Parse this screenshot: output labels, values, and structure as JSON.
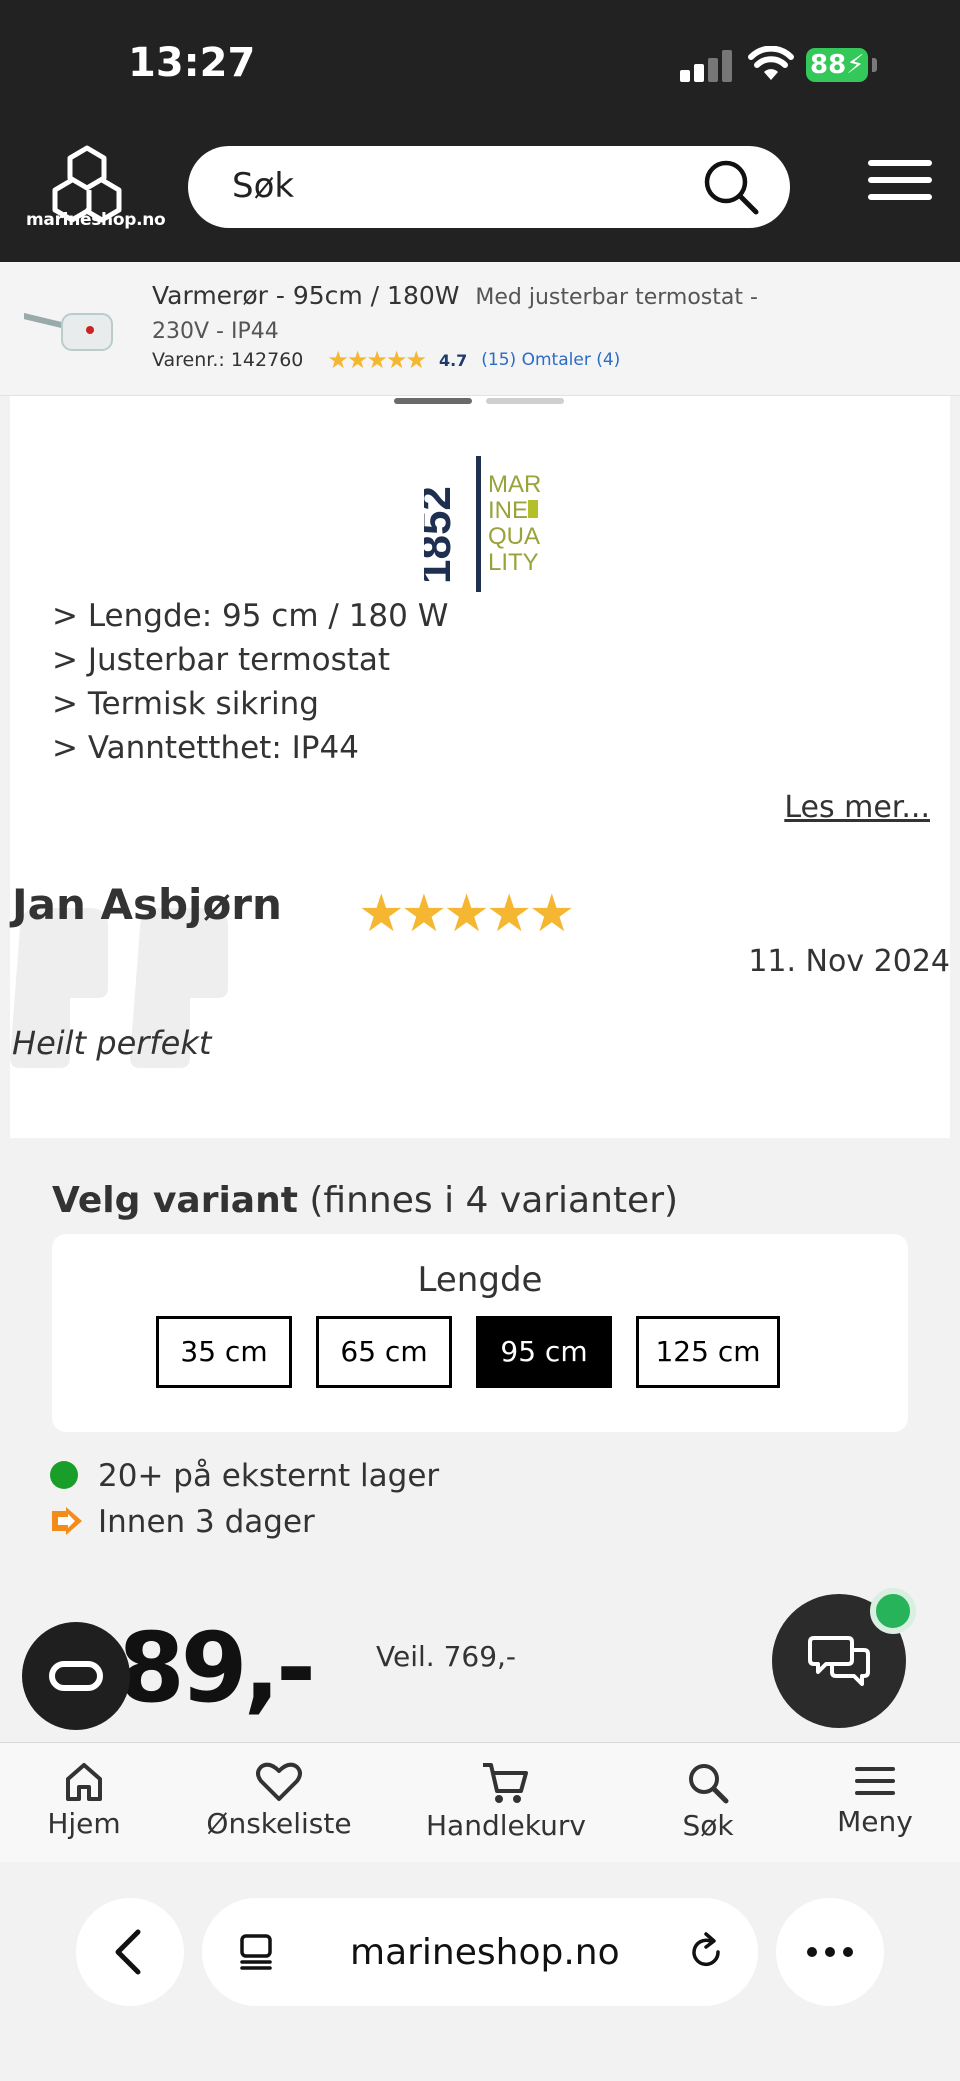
{
  "status_bar": {
    "time": "13:27",
    "battery": "88"
  },
  "header": {
    "logo_text": "marineshop.no",
    "search_placeholder": "Søk"
  },
  "product": {
    "title": "Varmerør - 95cm / 180W",
    "subtitle": "Med justerbar termostat - 230V - IP44",
    "sku": "Varenr.: 142760",
    "rating": "4.7",
    "rating_count": "(15)",
    "reviews_link": "Omtaler (4)"
  },
  "brand": {
    "year": "1852",
    "lines": [
      "MAR",
      "INE",
      "QUA",
      "LITY"
    ]
  },
  "features": [
    "> Lengde: 95 cm / 180 W",
    "> Justerbar termostat",
    "> Termisk sikring",
    "> Vanntetthet: IP44"
  ],
  "read_more": "Les mer...",
  "review": {
    "author": "Jan Asbjørn",
    "stars": "★★★★★",
    "date": "11. Nov 2024",
    "text": "Heilt perfekt"
  },
  "variant": {
    "title_bold": "Velg variant",
    "title_rest": "(finnes i 4 varianter)",
    "label": "Lengde",
    "options": [
      "35 cm",
      "65 cm",
      "95 cm",
      "125 cm"
    ],
    "selected": "95 cm"
  },
  "stock": {
    "availability": "20+ på eksternt lager",
    "delivery": "Innen 3 dager"
  },
  "price": {
    "current": "89,-",
    "suggested": "Veil. 769,-",
    "partial": "( ,   )"
  },
  "bottom_nav": [
    "Hjem",
    "Ønskeliste",
    "Handlekurv",
    "Søk",
    "Meny"
  ],
  "browser": {
    "url": "marineshop.no"
  },
  "colors": {
    "header_bg": "#222222",
    "star": "#f5b731",
    "selected_variant": "#000000",
    "in_stock": "#1a9e2a",
    "link": "#2a6cc7"
  }
}
